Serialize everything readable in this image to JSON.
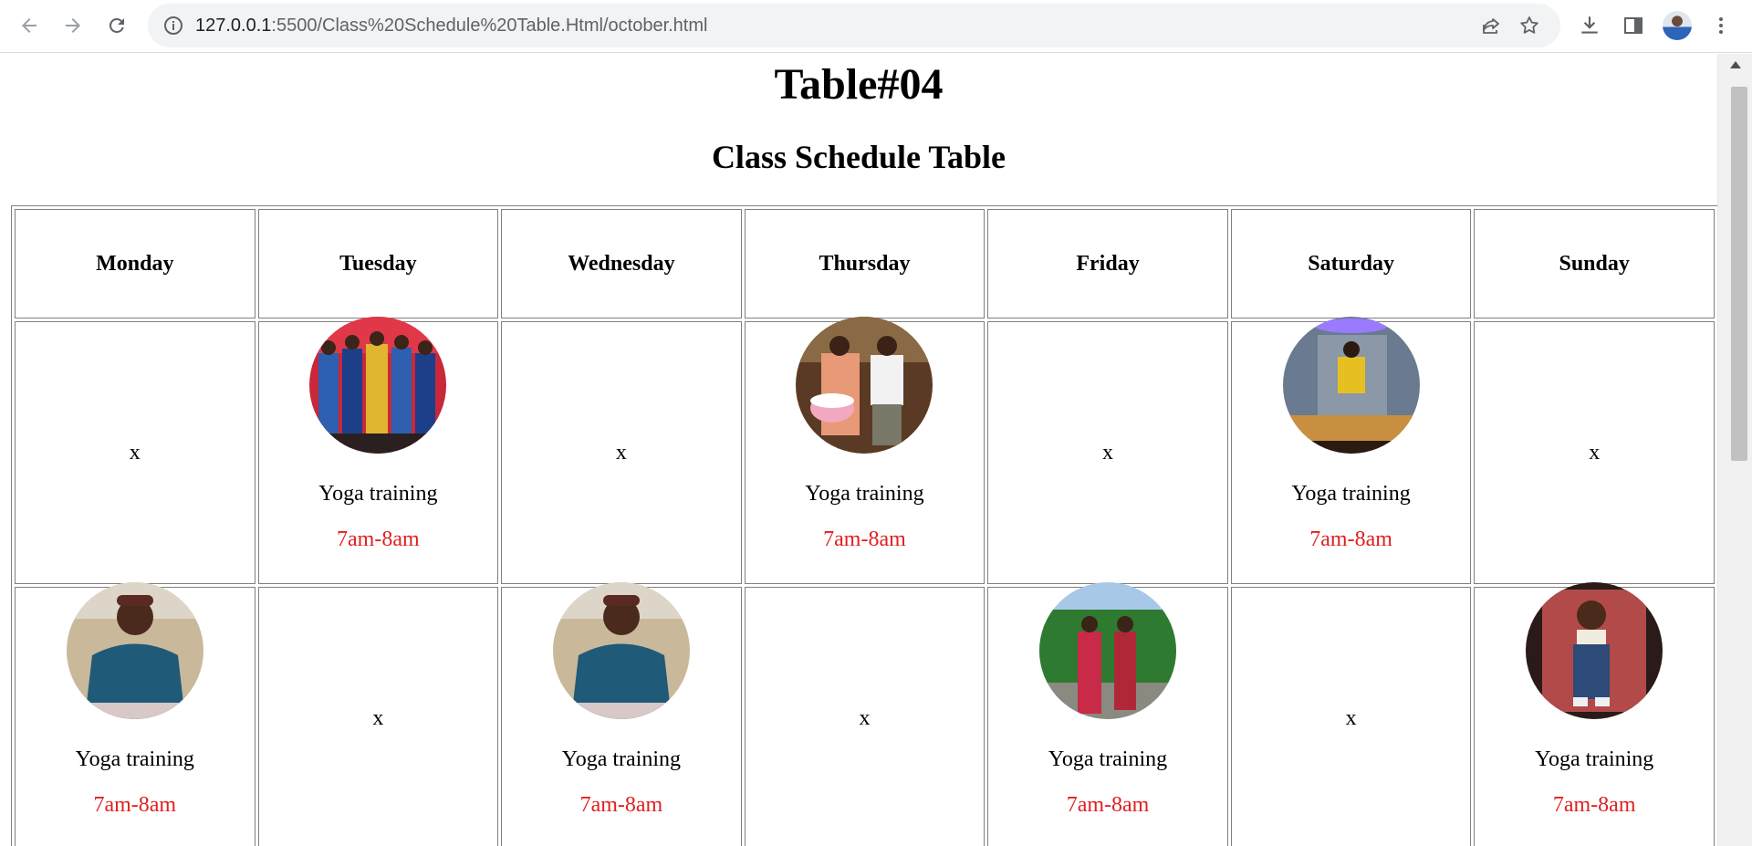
{
  "browser": {
    "url_host": "127.0.0.1",
    "url_path": ":5500/Class%20Schedule%20Table.Html/october.html"
  },
  "page": {
    "title": "Table#04",
    "subtitle": "Class Schedule Table"
  },
  "table": {
    "days": [
      "Monday",
      "Tuesday",
      "Wednesday",
      "Thursday",
      "Friday",
      "Saturday",
      "Sunday"
    ],
    "rows": [
      [
        {
          "empty": "x"
        },
        {
          "activity": "Yoga training",
          "time": "7am-8am",
          "photo": "group-graduation-photo"
        },
        {
          "empty": "x"
        },
        {
          "activity": "Yoga training",
          "time": "7am-8am",
          "photo": "birthday-cake-photo"
        },
        {
          "empty": "x"
        },
        {
          "activity": "Yoga training",
          "time": "7am-8am",
          "photo": "mirror-selfie-photo"
        },
        {
          "empty": "x"
        }
      ],
      [
        {
          "activity": "Yoga training",
          "time": "7am-8am",
          "photo": "man-in-cap-photo"
        },
        {
          "empty": "x"
        },
        {
          "activity": "Yoga training",
          "time": "7am-8am",
          "photo": "man-in-cap-photo"
        },
        {
          "empty": "x"
        },
        {
          "activity": "Yoga training",
          "time": "7am-8am",
          "photo": "two-men-red-outfits-photo"
        },
        {
          "empty": "x"
        },
        {
          "activity": "Yoga training",
          "time": "7am-8am",
          "photo": "child-overalls-photo"
        }
      ]
    ]
  },
  "colors": {
    "time_text": "#e02020",
    "border": "#808080"
  }
}
